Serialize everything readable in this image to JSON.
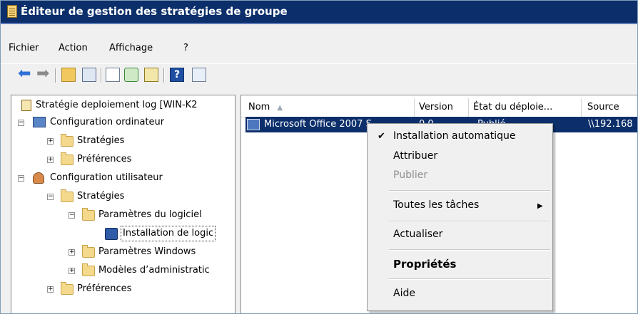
{
  "window": {
    "title": "Éditeur de gestion des stratégies de groupe",
    "app_icon": "gpo-editor-icon"
  },
  "menu": [
    "Fichier",
    "Action",
    "Affichage",
    "?"
  ],
  "toolbar": {
    "icons": [
      "back-arrow-icon",
      "forward-arrow-icon",
      "folder-up-icon",
      "show-hide-tree-icon",
      "page-icon",
      "refresh-icon",
      "export-list-icon",
      "help-icon",
      "properties-icon"
    ],
    "help_glyph": "?"
  },
  "tree": {
    "root": "Stratégie deploiement log [WIN-K2",
    "computer_config": "Configuration ordinateur",
    "computer_policies": "Stratégies",
    "computer_prefs": "Préférences",
    "user_config": "Configuration utilisateur",
    "user_policies": "Stratégies",
    "software_settings": "Paramètres du logiciel",
    "software_install": "Installation de logic",
    "windows_settings": "Paramètres Windows",
    "admin_templates": "Modèles d’administratic",
    "user_prefs": "Préférences",
    "expander_plus": "+",
    "expander_minus": "−"
  },
  "list": {
    "columns": [
      "Nom",
      "Version",
      "État du déploie...",
      "Source"
    ],
    "sort_indicator": "▲",
    "rows": [
      {
        "name": "Microsoft Office 2007 S",
        "version": "0.0",
        "state": "Publié",
        "source": "\\\\192.168"
      }
    ]
  },
  "context_menu": {
    "items": [
      "Installation automatique",
      "Attribuer",
      "Publier",
      "Toutes les tâches",
      "Actualiser",
      "Propriétés",
      "Aide"
    ],
    "checked_item": "Installation automatique",
    "disabled_item": "Publier",
    "check_glyph": "✔",
    "submenu_glyph": "▶"
  },
  "colors": {
    "title_bar": "#0c2f6b",
    "selection": "#0c2f6b",
    "menu_bg": "#f0f0f0"
  }
}
